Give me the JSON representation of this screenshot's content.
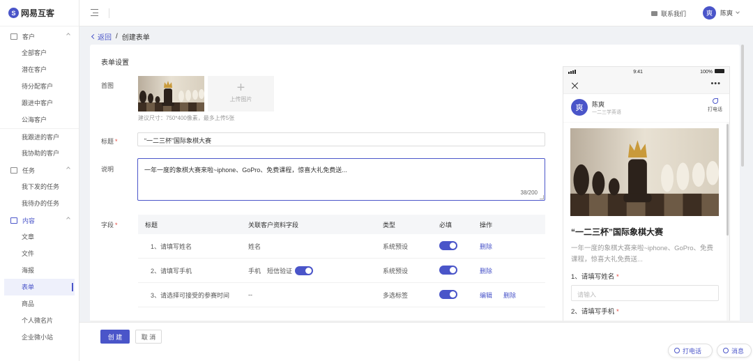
{
  "app": {
    "logo_mark": "S",
    "logo_text": "网易互客"
  },
  "sidebar": {
    "groups": [
      {
        "label": "客户",
        "items": [
          "全部客户",
          "潜在客户",
          "待分配客户",
          "跟进中客户",
          "公海客户",
          "我跟进的客户",
          "我协助的客户"
        ]
      },
      {
        "label": "任务",
        "items": [
          "我下发的任务",
          "我待办的任务"
        ]
      },
      {
        "label": "内容",
        "items": [
          "文章",
          "文件",
          "海报",
          "表单",
          "商品",
          "个人微名片",
          "企业微小站"
        ]
      }
    ],
    "selected": "表单"
  },
  "header": {
    "contact_label": "联系我们",
    "avatar_char": "爽",
    "user_name": "陈爽"
  },
  "breadcrumb": {
    "back": "返回",
    "separator": "/",
    "current": "创建表单"
  },
  "form": {
    "section_title": "表单设置",
    "cover_label": "首图",
    "upload_label": "上传图片",
    "upload_hint": "建议尺寸：750*400像素，最多上传5张",
    "title_label": "标题",
    "title_value": "“一二三杯”国际象棋大赛",
    "desc_label": "说明",
    "desc_value": "一年一度的象棋大赛来啦~iphone、GoPro、免费课程，惊喜大礼免费送...",
    "desc_counter": "38/200",
    "fields_label": "字段",
    "required_mark": "*",
    "table": {
      "headers": [
        "标题",
        "关联客户资料字段",
        "类型",
        "必填",
        "操作"
      ],
      "rows": [
        {
          "title": "1、请填写姓名",
          "field": "姓名",
          "verify": "",
          "type": "系统预设",
          "required": true,
          "actions": [
            "删除"
          ]
        },
        {
          "title": "2、请填写手机",
          "field": "手机",
          "verify": "短信验证",
          "type": "系统预设",
          "required": true,
          "actions": [
            "删除"
          ]
        },
        {
          "title": "3、请选择可接受的参赛时间",
          "field": "--",
          "verify": "",
          "type": "多选标签",
          "required": true,
          "actions": [
            "编辑",
            "删除"
          ]
        }
      ]
    }
  },
  "footer": {
    "create": "创 建",
    "cancel": "取 消",
    "call": "打电话",
    "message": "消息"
  },
  "preview": {
    "time": "9:41",
    "battery": "100%",
    "avatar_char": "爽",
    "name": "陈爽",
    "subtitle": "一二三学英语",
    "call_label": "打电话",
    "dots": "•••",
    "title": "“一二三杯”国际象棋大赛",
    "desc": "一年一度的象棋大赛来啦~iphone、GoPro、免费课程，惊喜大礼免费送...",
    "q1": "1、请填写姓名",
    "q1_placeholder": "请输入",
    "q2": "2、请填写手机",
    "required_mark": "*"
  },
  "colors": {
    "accent": "#4a55c9",
    "required": "#e5483e"
  }
}
